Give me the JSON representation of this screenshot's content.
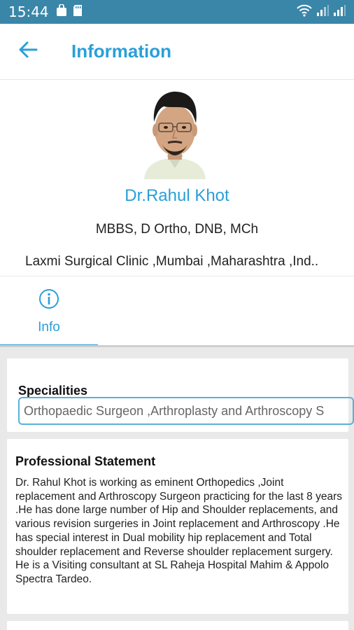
{
  "status_bar": {
    "time": "15:44",
    "left_icons": [
      "bag-icon",
      "sd-card-icon"
    ],
    "right_icons": [
      "wifi-icon",
      "signal-icon",
      "signal-icon"
    ]
  },
  "app_bar": {
    "title": "Information",
    "back_icon": "arrow-left-icon"
  },
  "profile": {
    "name": "Dr.Rahul Khot",
    "degrees": "MBBS, D Ortho, DNB, MCh",
    "clinic": "Laxmi Surgical Clinic ,Mumbai ,Maharashtra ,Ind.."
  },
  "tabs": [
    {
      "label": "Info",
      "icon": "info-circle-icon",
      "selected": true
    }
  ],
  "specialities": {
    "title": "Specialities",
    "value": "Orthopaedic Surgeon ,Arthroplasty and Arthroscopy S"
  },
  "professional_statement": {
    "title": "Professional Statement",
    "text": "Dr. Rahul Khot is working as eminent Orthopedics ,Joint replacement and Arthroscopy Surgeon practicing for the last 8 years .He has done large number of Hip and Shoulder replacements, and  various revision surgeries in Joint replacement and Arthroscopy .He has special interest in Dual mobility hip replacement and Total shoulder replacement and Reverse shoulder replacement  surgery. He is a Visiting consultant at SL Raheja Hospital Mahim & Appolo Spectra Tardeo."
  },
  "colors": {
    "status_bar": "#3a86a8",
    "accent": "#2a9fd8",
    "background_grey": "#e9e9e9"
  }
}
